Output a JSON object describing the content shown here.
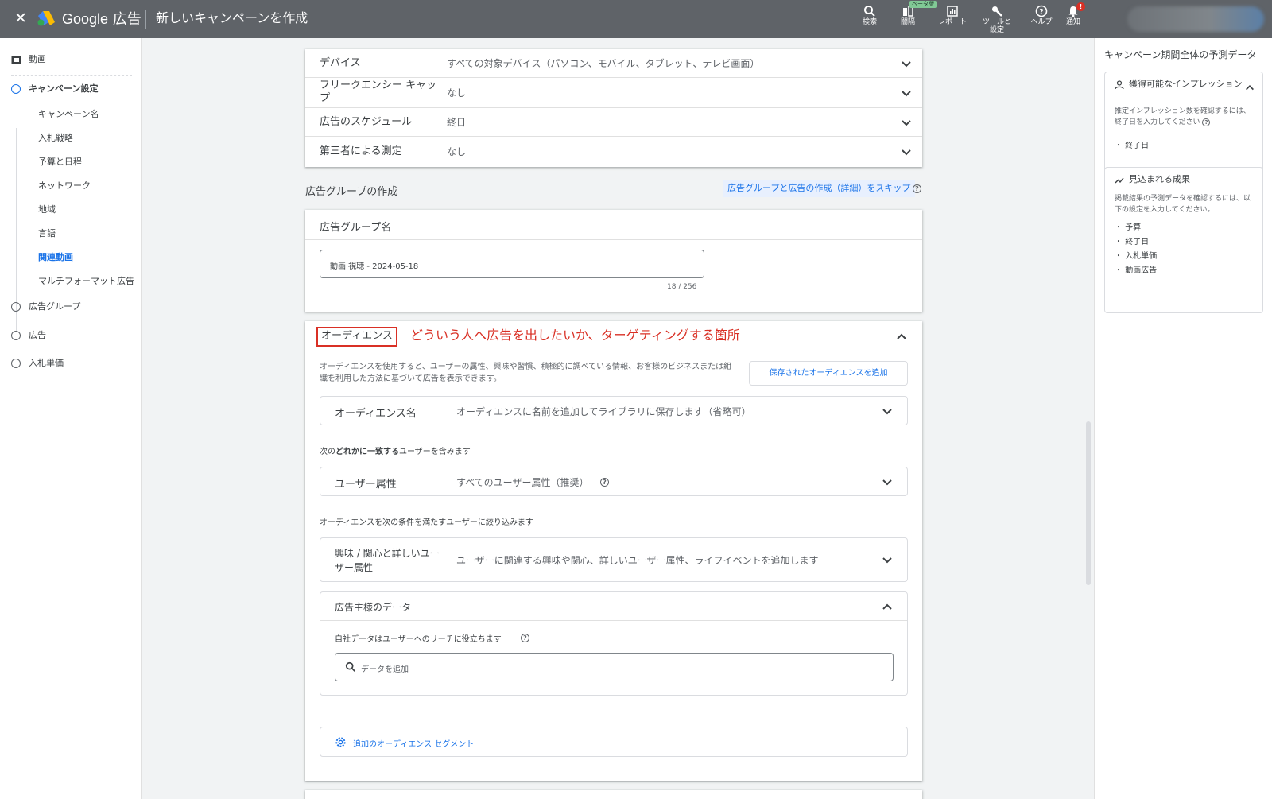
{
  "header": {
    "close_glyph": "✕",
    "brand_google": "Google",
    "brand_ads": "広告",
    "page_title": "新しいキャンペーンを作成",
    "tools": [
      {
        "label": "検索",
        "icon": "search-icon"
      },
      {
        "label": "闇隔",
        "icon": "appearance-icon",
        "badge": "ベータ版"
      },
      {
        "label": "レポート",
        "icon": "reports-icon"
      },
      {
        "label": "ツールと",
        "label2": "設定",
        "icon": "wrench-icon"
      },
      {
        "label": "ヘルプ",
        "icon": "help-icon"
      },
      {
        "label": "通知",
        "icon": "bell-icon",
        "badge": "!"
      }
    ]
  },
  "sidebar": {
    "top_item": "動画",
    "campaign_settings": "キャンペーン設定",
    "sub_items": [
      "キャンペーン名",
      "入札戦略",
      "予算と日程",
      "ネットワーク",
      "地域",
      "言語",
      "関連動画",
      "マルチフォーマット広告"
    ],
    "active_sub": "関連動画",
    "bottom_items": [
      "広告グループ",
      "広告",
      "入札単価"
    ]
  },
  "settings_rows": [
    {
      "key": "デバイス",
      "value": "すべての対象デバイス（パソコン、モバイル、タブレット、テレビ画面）"
    },
    {
      "key": "フリークエンシー キャップ",
      "value": "なし"
    },
    {
      "key": "広告のスケジュール",
      "value": "終日"
    },
    {
      "key": "第三者による測定",
      "value": "なし"
    }
  ],
  "ad_group": {
    "section_title": "広告グループの作成",
    "skip_link": "広告グループと広告の作成（詳細）をスキップ",
    "name_label": "広告グループ名",
    "name_value": "動画 視聴 - 2024-05-18",
    "char_count": "18 / 256"
  },
  "audience": {
    "title": "オーディエンス",
    "annotation": "どういう人へ広告を出したいか、ターゲティングする箇所",
    "description": "オーディエンスを使用すると、ユーザーの属性、興味や習慣、積極的に調べている情報、お客様のビジネスまたは組織を利用した方法に基づいて広告を表示できます。",
    "saved_button": "保存されたオーディエンスを追加",
    "name_key": "オーディエンス名",
    "name_value": "オーディエンスに名前を追加してライブラリに保存します（省略可）",
    "include_prefix": "次の",
    "include_bold": "どれかに一致する",
    "include_suffix": "ユーザーを含みます",
    "demographics_key": "ユーザー属性",
    "demographics_value": "すべてのユーザー属性（推奨）",
    "narrow_text": "オーディエンスを次の条件を満たすユーザーに絞り込みます",
    "interests_key": "興味 / 関心と詳しいユーザー属性",
    "interests_value": "ユーザーに関連する興味や関心、詳しいユーザー属性、ライフイベントを追加します",
    "advertiser_data_title": "広告主様のデータ",
    "advertiser_data_note": "自社データはユーザーへのリーチに役立ちます",
    "search_placeholder": "データを追加",
    "additional_segments": "追加のオーディエンス セグメント"
  },
  "right_panel": {
    "title": "キャンペーン期間全体の予測データ",
    "card1_title": "獲得可能なインプレッション",
    "card1_desc": "推定インプレッション数を確認するには、終了日を入力してください",
    "card1_items": [
      "終了日"
    ],
    "card2_title": "見込まれる成果",
    "card2_desc": "掲載結果の予測データを確認するには、以下の設定を入力してください。",
    "card2_items": [
      "予算",
      "終了日",
      "入札単価",
      "動画広告"
    ]
  },
  "colors": {
    "topbar": "#5f6368",
    "accent": "#1a73e8",
    "annotation_red": "#d93025"
  }
}
